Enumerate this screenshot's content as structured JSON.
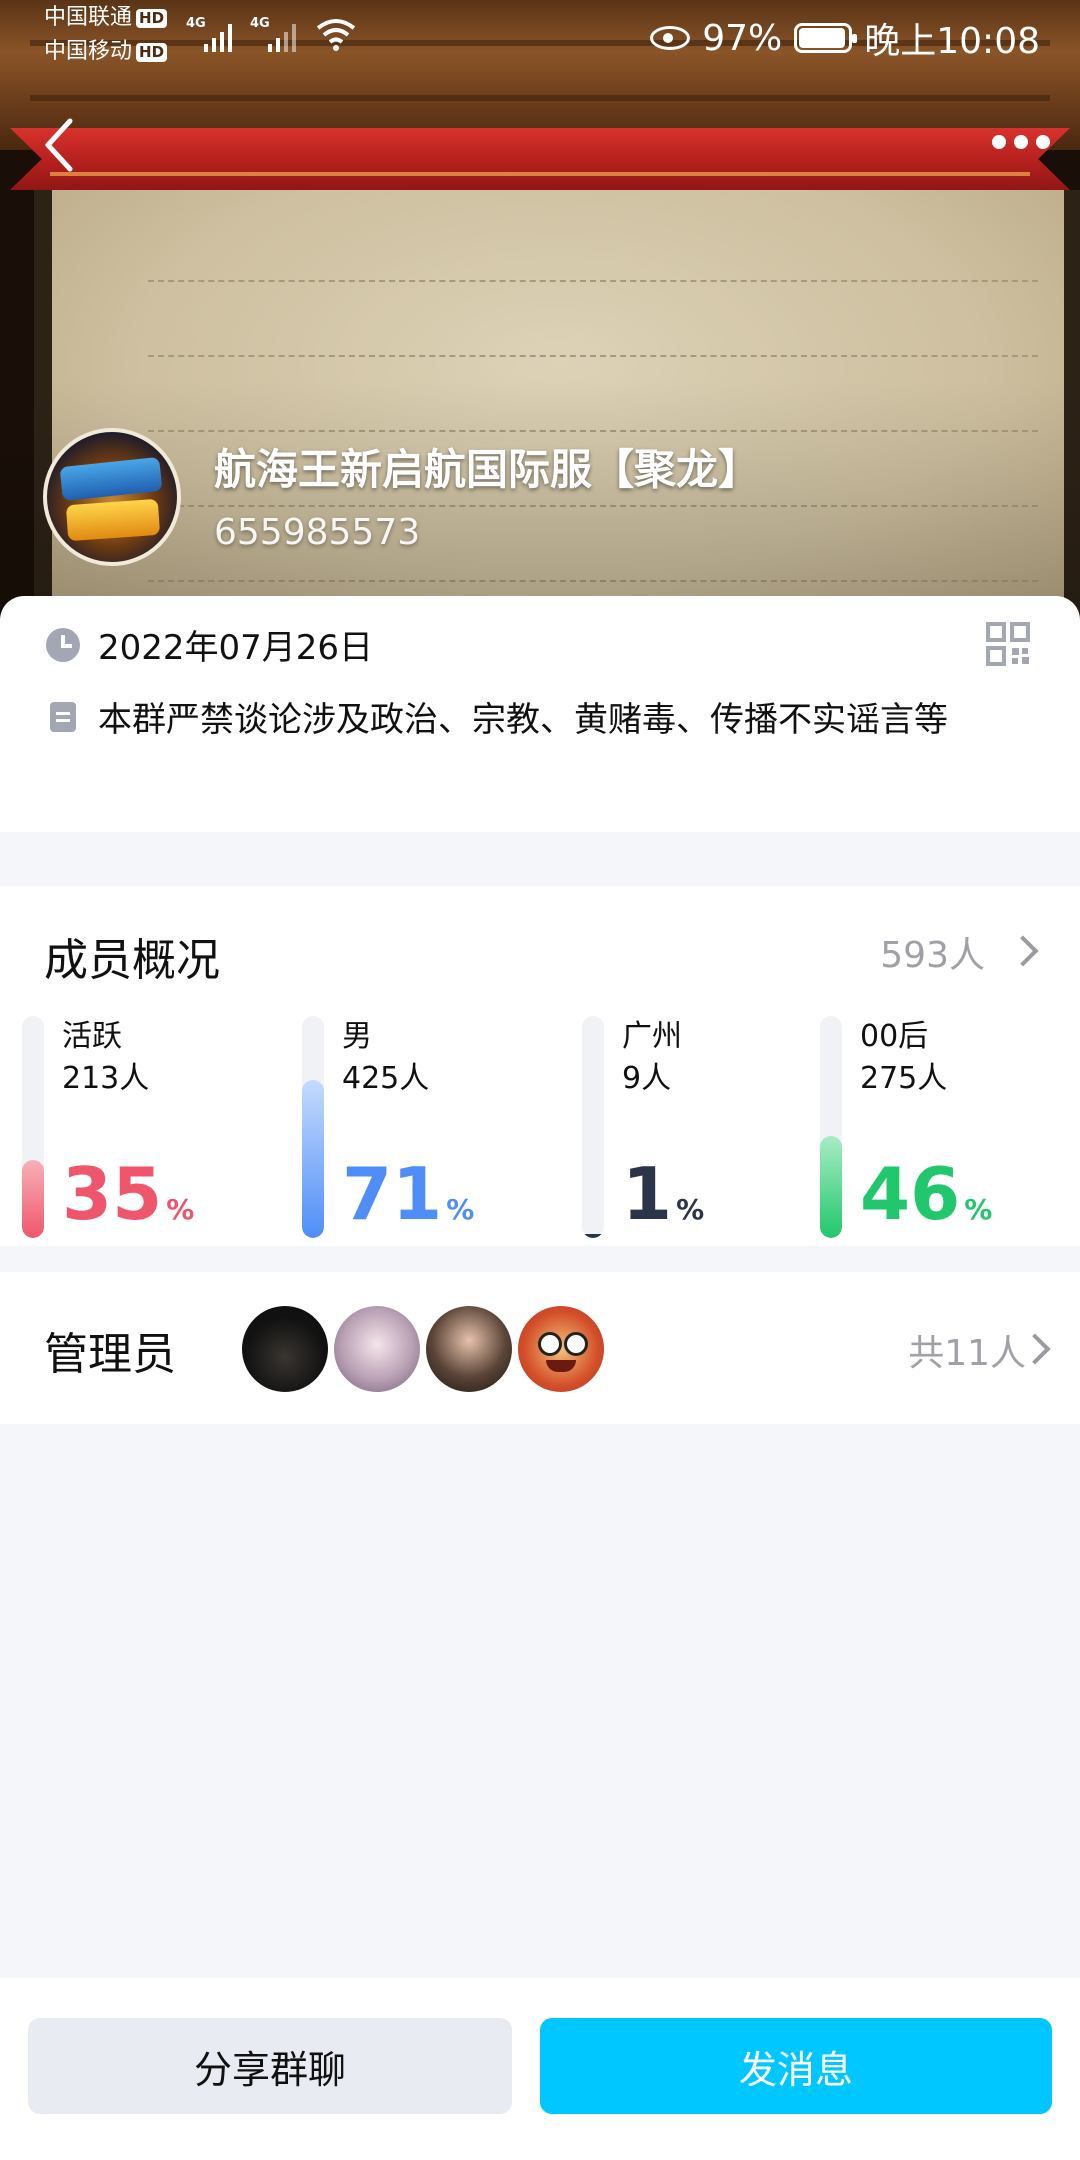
{
  "status_bar": {
    "carrier1": "中国联通",
    "carrier2": "中国移动",
    "hd": "HD",
    "net1": "4G",
    "net2": "4G",
    "battery": "97%",
    "time": "晚上10:08"
  },
  "group": {
    "name": "航海王新启航国际服【聚龙】",
    "id": "655985573"
  },
  "info": {
    "date": "2022年07月26日",
    "notice": "本群严禁谈论涉及政治、宗教、黄赌毒、传播不实谣言等"
  },
  "members": {
    "title": "成员概况",
    "count": "593人",
    "stats": [
      {
        "label": "活跃",
        "count": "213人",
        "percent": "35",
        "unit": "%",
        "color": "#f0566b"
      },
      {
        "label": "男",
        "count": "425人",
        "percent": "71",
        "unit": "%",
        "color": "#4f8ef7"
      },
      {
        "label": "广州",
        "count": "9人",
        "percent": "1",
        "unit": "%",
        "color": "#2b3448"
      },
      {
        "label": "00后",
        "count": "275人",
        "percent": "46",
        "unit": "%",
        "color": "#21c76d"
      }
    ]
  },
  "admins": {
    "title": "管理员",
    "count": "共11人"
  },
  "actions": {
    "share": "分享群聊",
    "send": "发消息"
  }
}
